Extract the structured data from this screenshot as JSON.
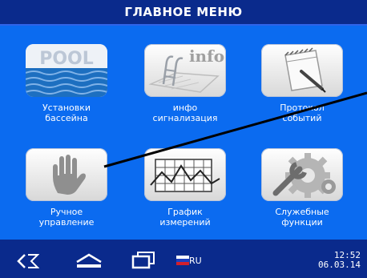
{
  "title": "ГЛАВНОЕ МЕНЮ",
  "menu": [
    {
      "label1": "Установки",
      "label2": "бассейна",
      "icon": "pool-icon",
      "icon_text": "POOL"
    },
    {
      "label1": "инфо",
      "label2": "сигнализация",
      "icon": "info-icon",
      "icon_text": "info"
    },
    {
      "label1": "Протокол",
      "label2": "событий",
      "icon": "notebook-icon"
    },
    {
      "label1": "Ручное",
      "label2": "управление",
      "icon": "hand-icon"
    },
    {
      "label1": "График",
      "label2": "измерений",
      "icon": "chart-icon"
    },
    {
      "label1": "Служебные",
      "label2": "функции",
      "icon": "gear-wrench-icon"
    }
  ],
  "bottom": {
    "lang": "RU",
    "time": "12:52",
    "date": "06.03.14"
  },
  "colors": {
    "background": "#0b6bf0",
    "bars": "#0a2a8c",
    "accent": "#2f63e8"
  }
}
